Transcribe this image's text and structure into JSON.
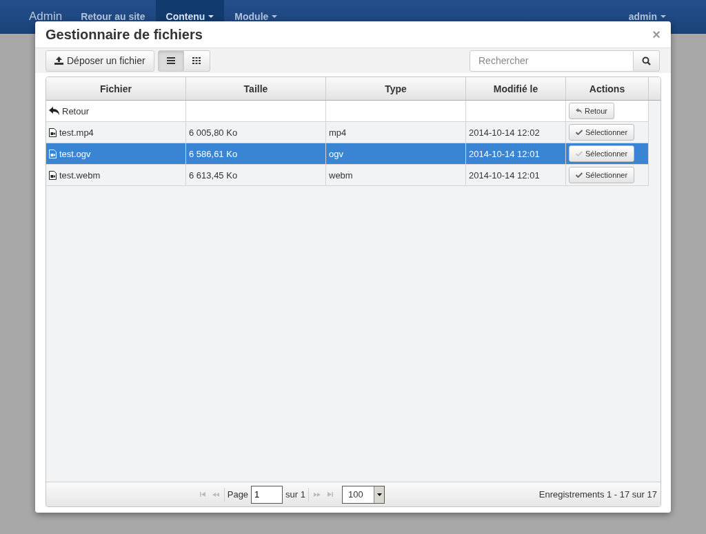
{
  "navbar": {
    "brand": "Admin",
    "items": [
      {
        "label": "Retour au site",
        "selected": false,
        "dropdown": false
      },
      {
        "label": "Contenu",
        "selected": true,
        "dropdown": true
      },
      {
        "label": "Module",
        "selected": false,
        "dropdown": true
      }
    ],
    "user": "admin"
  },
  "dialog": {
    "title": "Gestionnaire de fichiers",
    "close": "×",
    "toolbar": {
      "upload": "Déposer un fichier",
      "views": [
        {
          "kind": "list",
          "selected": true
        },
        {
          "kind": "grid",
          "selected": false
        }
      ],
      "search": {
        "placeholder": "Rechercher"
      }
    },
    "table": {
      "columns": [
        "Fichier",
        "Taille",
        "Type",
        "Modifié le",
        "Actions"
      ],
      "rows": [
        {
          "kind": "back",
          "name": "Retour",
          "size": "",
          "type": "",
          "modified": "",
          "action": "Retour",
          "selected": false
        },
        {
          "kind": "file",
          "name": "test.mp4",
          "size": "6 005,80 Ko",
          "type": "mp4",
          "modified": "2014-10-14 12:02",
          "action": "Sélectionner",
          "selected": false
        },
        {
          "kind": "file",
          "name": "test.ogv",
          "size": "6 586,61 Ko",
          "type": "ogv",
          "modified": "2014-10-14 12:01",
          "action": "Sélectionner",
          "selected": true
        },
        {
          "kind": "file",
          "name": "test.webm",
          "size": "6 613,45 Ko",
          "type": "webm",
          "modified": "2014-10-14 12:01",
          "action": "Sélectionner",
          "selected": false
        }
      ]
    },
    "pager": {
      "page_label": "Page",
      "page": "1",
      "of": "sur 1",
      "per_page": "100",
      "records": "Enregistrements 1 - 17 sur 17"
    }
  }
}
